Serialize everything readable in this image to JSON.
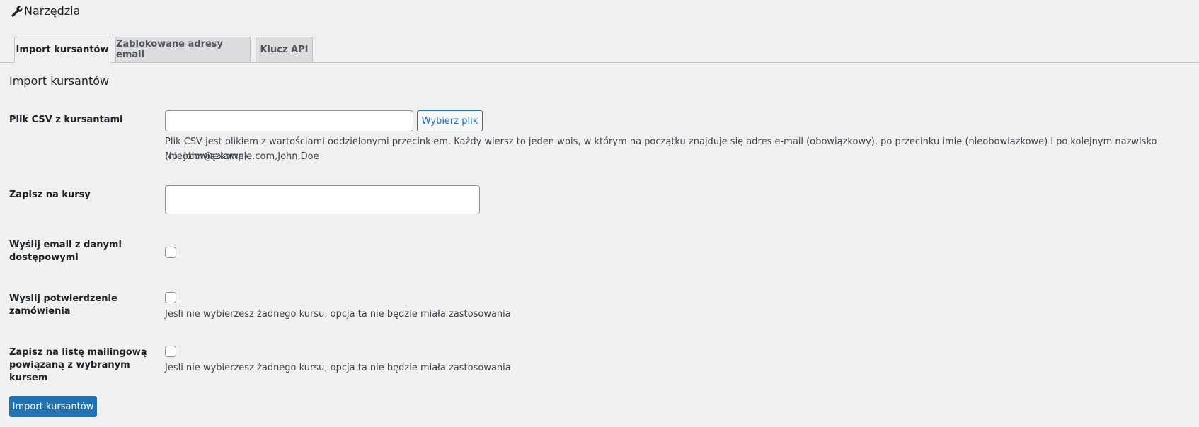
{
  "page": {
    "title": "Narzędzia",
    "title_icon": "wrench-icon"
  },
  "tabs": [
    {
      "label": "Import kursantów",
      "active": true
    },
    {
      "label": "Zablokowane adresy email",
      "active": false
    },
    {
      "label": "Klucz API",
      "active": false
    }
  ],
  "section": {
    "title": "Import kursantów"
  },
  "form": {
    "csv": {
      "label": "Plik CSV z kursantami",
      "value": "",
      "button_label": "Wybierz plik",
      "description_line1": "Plik CSV jest plikiem z wartościami oddzielonymi przecinkiem. Każdy wiersz to jeden wpis, w którym na początku znajduje się adres e-mail (obowiązkowy), po przecinku imię (nieobowiązkowe) i po kolejnym nazwisko (nieobowiązkowe).",
      "description_line2": "Np. john@example.com,John,Doe"
    },
    "courses": {
      "label": "Zapisz na kursy",
      "value": ""
    },
    "send_access_email": {
      "label_line1": "Wyślij email z danymi",
      "label_line2": "dostępowymi",
      "checked": false
    },
    "send_order_confirmation": {
      "label_line1": "Wyslij potwierdzenie",
      "label_line2": "zamówienia",
      "checked": false,
      "description": "Jesli nie wybierzesz żadnego kursu, opcja ta nie będzie miała zastosowania"
    },
    "mailing_list": {
      "label_line1": "Zapisz na listę mailingową",
      "label_line2": "powiązaną z wybranym kursem",
      "checked": false,
      "description": "Jesli nie wybierzesz żadnego kursu, opcja ta nie będzie miała zastosowania"
    },
    "submit_label": "Import kursantów"
  },
  "colors": {
    "accent": "#2271b1",
    "background": "#f0f0f1",
    "tab_inactive": "#dcdcde"
  }
}
